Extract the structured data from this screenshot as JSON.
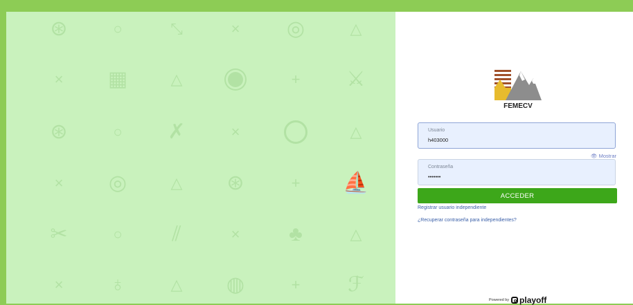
{
  "background": {
    "accent_color": "#8dcc55",
    "pattern_color": "#c9f2bd",
    "icons": [
      "basketball-icon",
      "circle-icon",
      "racket-icon",
      "cross-icon",
      "volleyball-icon",
      "triangle-icon",
      "cross-icon",
      "goal-net-icon",
      "triangle-icon",
      "target-icon",
      "plus-icon",
      "trophy-icon",
      "lifebuoy-icon",
      "circle-icon",
      "crossed-sticks-icon",
      "cross-icon",
      "horseshoe-icon",
      "triangle-icon",
      "cross-icon",
      "archery-target-icon",
      "triangle-icon",
      "basketball-icon",
      "plus-icon",
      "sailboat-icon",
      "kayak-icon",
      "circle-icon",
      "ruler-icon",
      "cross-icon",
      "shirt-icon",
      "triangle-icon",
      "cross-icon",
      "paddle-icon",
      "triangle-icon",
      "tennis-ball-icon",
      "plus-icon",
      "feather-icon"
    ]
  },
  "login": {
    "logo_text": "FEMECV",
    "username": {
      "label": "Usuario",
      "value": "h403000"
    },
    "password": {
      "label": "Contraseña",
      "value": "•••••••"
    },
    "show_label": "Mostrar",
    "submit_label": "ACCEDER",
    "submit_color": "#3da71a",
    "register_link": "Registrar usuario independiente",
    "recover_link": "¿Recuperar contraseña para independientes?",
    "powered_prefix": "Powered by",
    "powered_brand": "playoff"
  }
}
